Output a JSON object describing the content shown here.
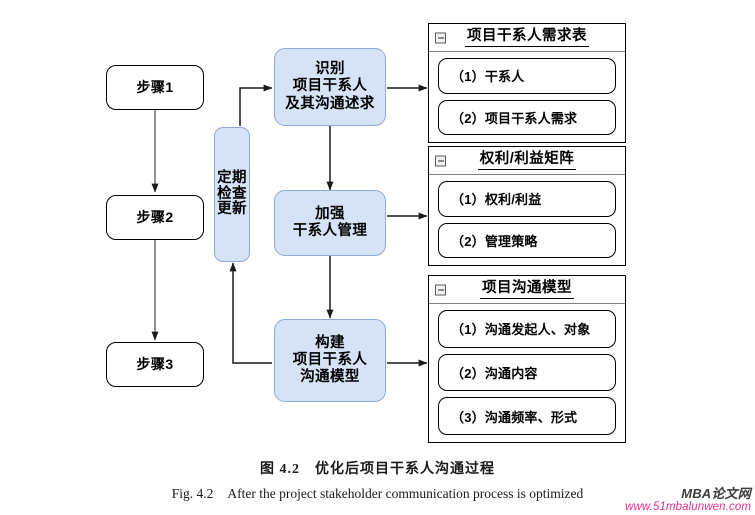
{
  "flow": {
    "steps": [
      {
        "label": "步骤1"
      },
      {
        "label": "步骤2"
      },
      {
        "label": "步骤3"
      }
    ],
    "recurring": {
      "chars": [
        "定期",
        "检查",
        "更新"
      ]
    },
    "processes": [
      {
        "lines": [
          "识别",
          "项目干系人",
          "及其沟通述求"
        ]
      },
      {
        "lines": [
          "加强",
          "干系人管理"
        ]
      },
      {
        "lines": [
          "构建",
          "项目干系人",
          "沟通模型"
        ]
      }
    ]
  },
  "panels": [
    {
      "title": "项目干系人需求表",
      "icon": "collapse-minus-icon",
      "items": [
        "（1）干系人",
        "（2）项目干系人需求"
      ]
    },
    {
      "title": "权利/利益矩阵",
      "icon": "collapse-minus-icon",
      "items": [
        "（1）权利/利益",
        "（2）管理策略"
      ]
    },
    {
      "title": "项目沟通模型",
      "icon": "collapse-minus-icon",
      "items": [
        "（1）沟通发起人、对象",
        "（2）沟通内容",
        "（3）沟通频率、形式"
      ]
    }
  ],
  "caption": {
    "cn": "图 4.2　优化后项目干系人沟通过程",
    "en_figno": "Fig. 4.2",
    "en_text": "After the project stakeholder communication process is optimized"
  },
  "watermark": {
    "brand": "MBA论文网",
    "url": "www.51mbalunwen.com"
  },
  "colors": {
    "process_fill": "#d6e3f6",
    "process_stroke": "#8fa9d4",
    "line": "#1a1a1a",
    "watermark_url": "#e0308f"
  }
}
